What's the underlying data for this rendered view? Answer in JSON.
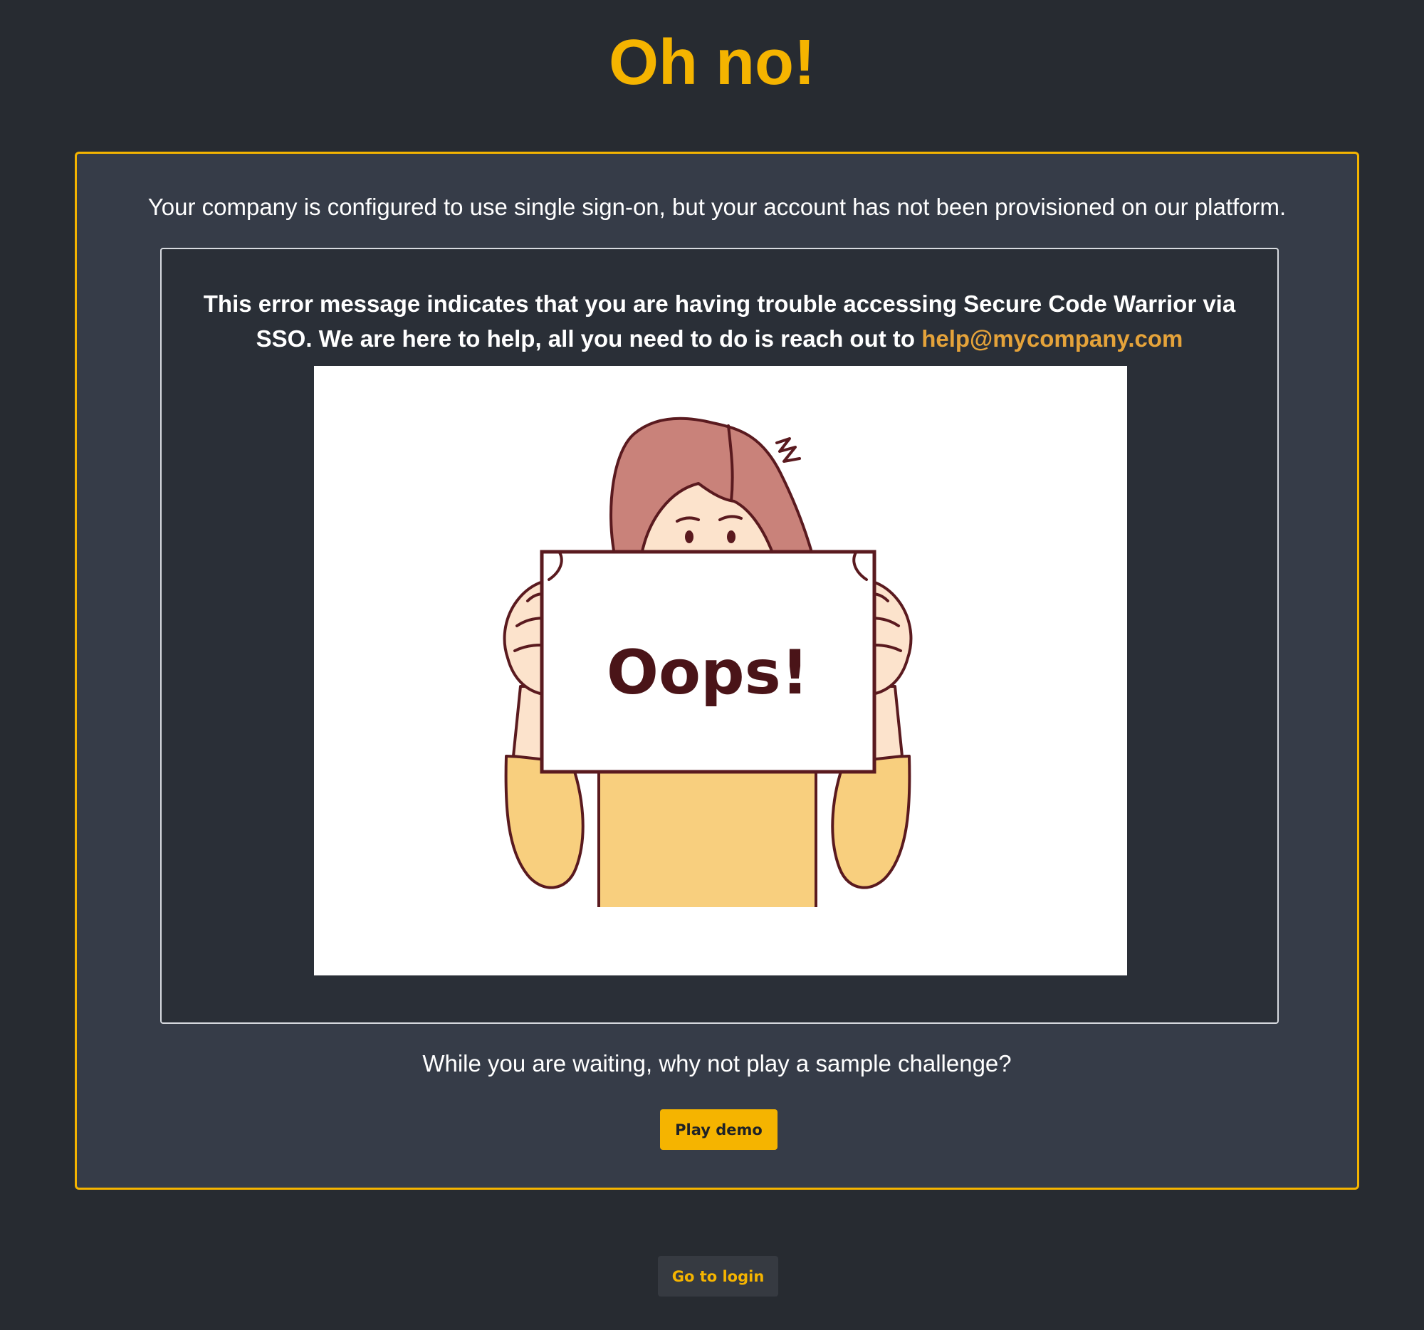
{
  "page": {
    "title": "Oh no!"
  },
  "card": {
    "intro": "Your company is configured to use single sign-on, but your account has not been provisioned on our platform.",
    "help_text": "This error message indicates that you are having trouble accessing Secure Code Warrior via SSO. We are here to help, all you need to do is reach out to",
    "help_email": "help@mycompany.com",
    "illustration": {
      "sign_text": "Oops!",
      "icon": "oops-illustration"
    },
    "waiting_text": "While you are waiting, why not play a sample challenge?",
    "play_demo_label": "Play demo"
  },
  "footer": {
    "go_to_login_label": "Go to login"
  },
  "colors": {
    "background": "#272b31",
    "accent": "#f5b400",
    "card": "#363c48",
    "inner_panel": "#2a2f37",
    "link": "#e5a33a"
  }
}
